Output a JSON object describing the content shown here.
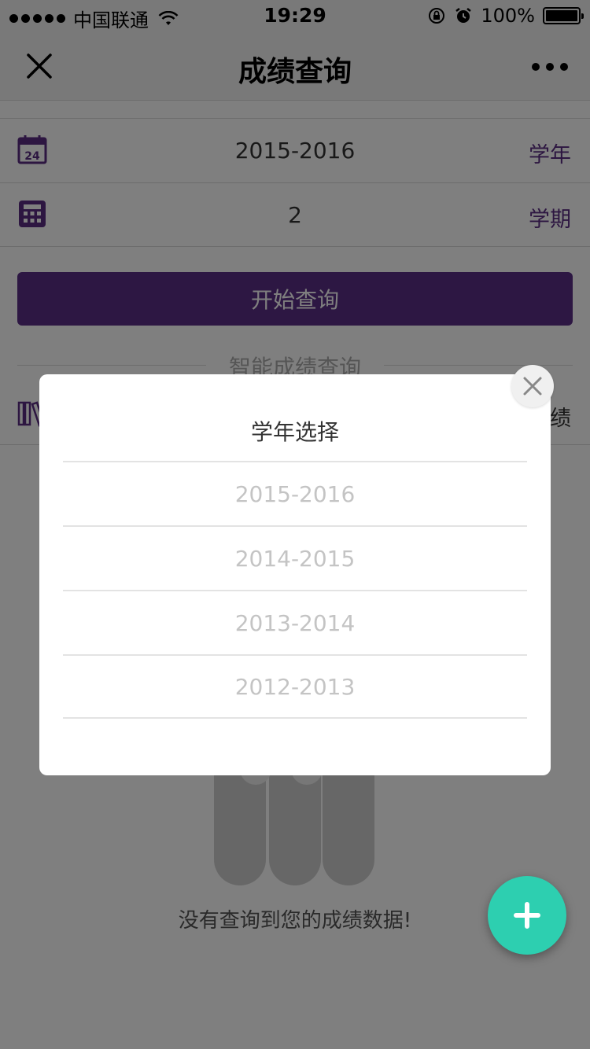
{
  "status_bar": {
    "carrier": "中国联通",
    "time": "19:29",
    "battery": "100%"
  },
  "nav": {
    "title": "成绩查询"
  },
  "form": {
    "year_value": "2015-2016",
    "year_label": "学年",
    "term_value": "2",
    "term_label": "学期",
    "calendar_icon_text": "24",
    "query_button": "开始查询",
    "smart_query_label": "智能成绩查询",
    "scores_label": "绩"
  },
  "empty": {
    "message": "没有查询到您的成绩数据!"
  },
  "modal": {
    "title": "学年选择",
    "options": [
      "2015-2016",
      "2014-2015",
      "2013-2014",
      "2012-2013"
    ]
  },
  "colors": {
    "accent": "#5b2e86",
    "fab": "#2dcfb0",
    "overlay": "rgba(0,0,0,0.5)"
  }
}
